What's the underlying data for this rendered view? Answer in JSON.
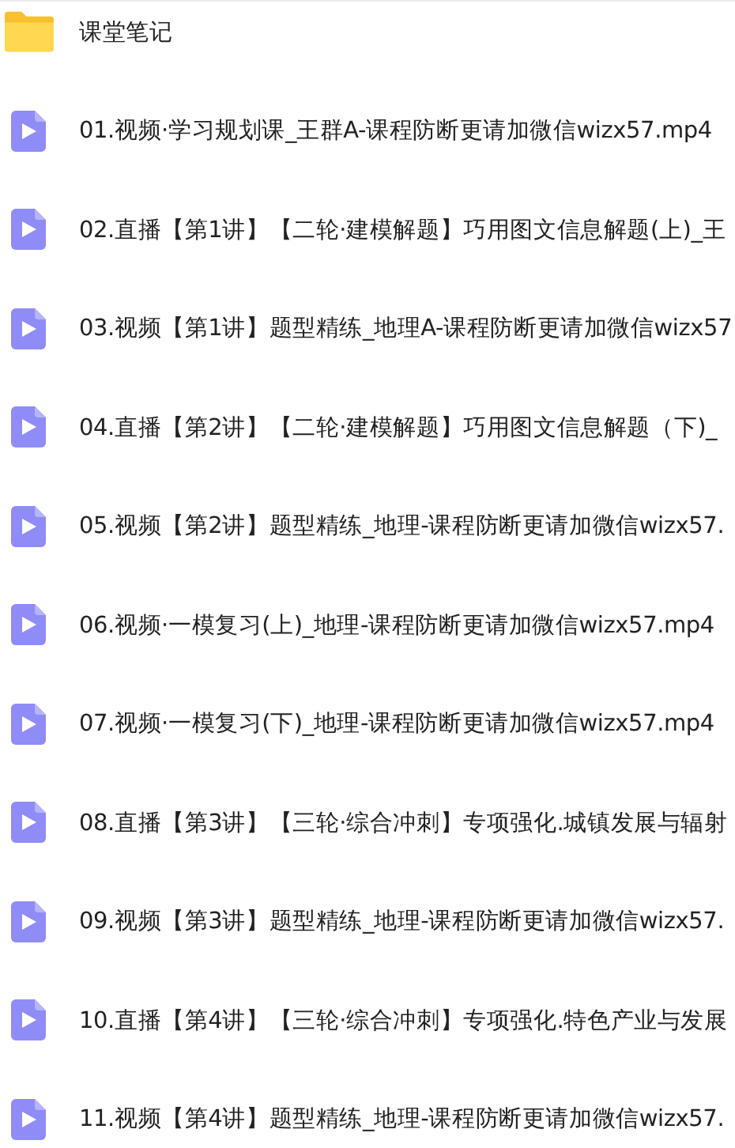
{
  "items": [
    {
      "kind": "folder",
      "name": "课堂笔记"
    },
    {
      "kind": "video",
      "name": "01.视频·学习规划课_王群A-课程防断更请加微信wizx57.mp4"
    },
    {
      "kind": "video",
      "name": "02.直播【第1讲】【二轮·建模解题】巧用图文信息解题(上)_王"
    },
    {
      "kind": "video",
      "name": "03.视频【第1讲】题型精练_地理A-课程防断更请加微信wizx57"
    },
    {
      "kind": "video",
      "name": "04.直播【第2讲】【二轮·建模解题】巧用图文信息解题（下)_"
    },
    {
      "kind": "video",
      "name": "05.视频【第2讲】题型精练_地理-课程防断更请加微信wizx57."
    },
    {
      "kind": "video",
      "name": "06.视频·一模复习(上)_地理-课程防断更请加微信wizx57.mp4"
    },
    {
      "kind": "video",
      "name": "07.视频·一模复习(下)_地理-课程防断更请加微信wizx57.mp4"
    },
    {
      "kind": "video",
      "name": "08.直播【第3讲】【三轮·综合冲刺】专项强化.城镇发展与辐射"
    },
    {
      "kind": "video",
      "name": "09.视频【第3讲】题型精练_地理-课程防断更请加微信wizx57."
    },
    {
      "kind": "video",
      "name": "10.直播【第4讲】【三轮·综合冲刺】专项强化.特色产业与发展"
    },
    {
      "kind": "video",
      "name": "11.视频【第4讲】题型精练_地理-课程防断更请加微信wizx57."
    }
  ]
}
